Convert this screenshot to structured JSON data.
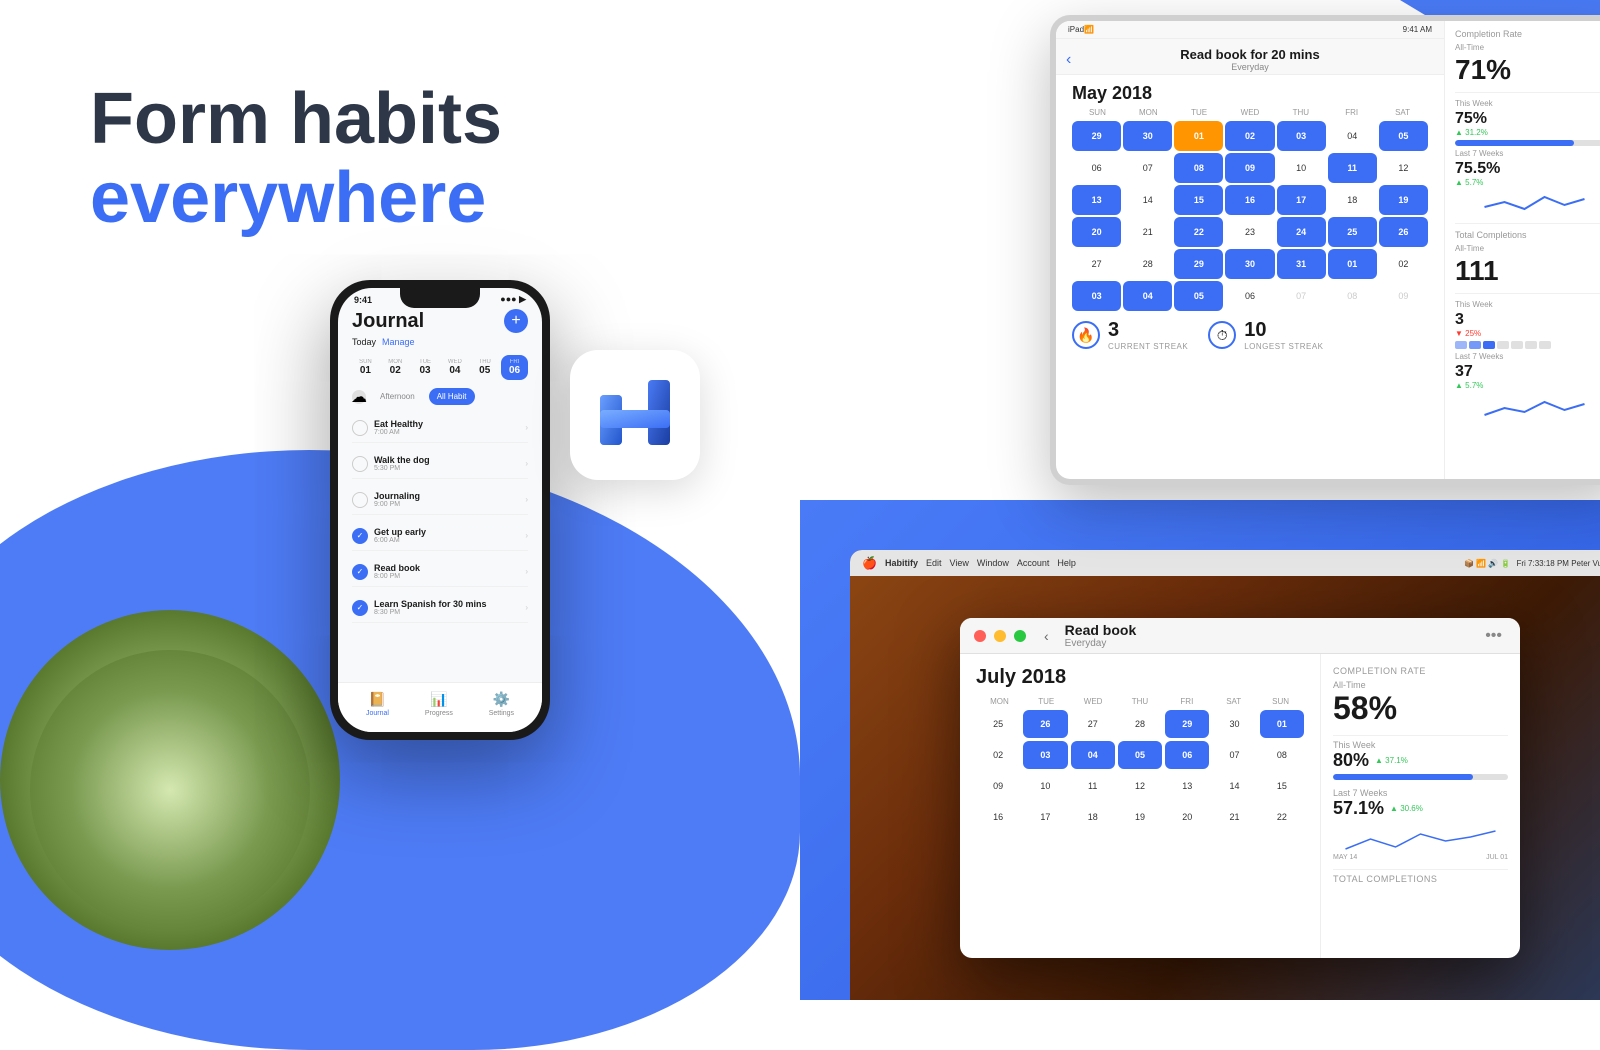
{
  "headline": {
    "line1": "Form habits",
    "line2": "everywhere"
  },
  "iphone": {
    "status_time": "9:41",
    "status_signal": "●●●",
    "title": "Journal",
    "today_label": "Today",
    "manage_label": "Manage",
    "add_button": "+",
    "dates": [
      {
        "day": "SUN",
        "num": "01",
        "active": false
      },
      {
        "day": "MON",
        "num": "02",
        "active": false
      },
      {
        "day": "TUE",
        "num": "03",
        "active": false
      },
      {
        "day": "WED",
        "num": "04",
        "active": false
      },
      {
        "day": "THU",
        "num": "05",
        "active": false
      },
      {
        "day": "FRI",
        "num": "06",
        "active": true
      }
    ],
    "filter_afternoon": "Afternoon",
    "filter_all": "All Habit",
    "habits": [
      {
        "name": "Eat Healthy",
        "time": "7:00 AM",
        "checked": false
      },
      {
        "name": "Walk the dog",
        "time": "5:30 PM",
        "checked": false
      },
      {
        "name": "Journaling",
        "time": "9:00 PM",
        "checked": false
      },
      {
        "name": "Get up early",
        "time": "6:00 AM",
        "checked": true
      },
      {
        "name": "Read book",
        "time": "8:00 PM",
        "checked": true
      },
      {
        "name": "Learn Spanish for 30 mins",
        "time": "8:30 PM",
        "checked": true
      }
    ],
    "nav_journal": "Journal",
    "nav_progress": "Progress",
    "nav_settings": "Settings"
  },
  "ipad": {
    "status_left": "iPad",
    "status_time": "9:41 AM",
    "back_label": "‹",
    "title": "Read book for 20 mins",
    "subtitle": "Everyday",
    "month": "May 2018",
    "days_header": [
      "SUN",
      "MON",
      "TUE",
      "WED",
      "THU",
      "FRI",
      "SAT"
    ],
    "current_streak_val": "3",
    "current_streak_label": "CURRENT STREAK",
    "longest_streak_val": "10",
    "longest_streak_label": "LONGEST STREAK",
    "stats": {
      "title": "Completion Rate",
      "all_time_label": "All-Time",
      "all_time_val": "71%",
      "this_week_label": "This Week",
      "this_week_val": "75%",
      "this_week_change": "▲ 31.2%",
      "last_7_label": "Last 7 Weeks",
      "last_7_val": "75.5%",
      "last_7_change": "▲ 5.7%",
      "total_title": "Total Completions",
      "total_all_label": "All-Time",
      "total_all_val": "111",
      "total_week_label": "This Week",
      "total_week_val": "3",
      "total_week_change": "▼ 25%",
      "total_7_label": "Last 7 Weeks",
      "total_7_val": "37",
      "total_7_change": "▲ 5.7%"
    }
  },
  "mac": {
    "menubar_apple": "",
    "menubar_app": "Habitify",
    "menu_edit": "Edit",
    "menu_view": "View",
    "menu_window": "Window",
    "menu_account": "Account",
    "menu_help": "Help",
    "menubar_right": "Fri 7:33:18 PM  Peter Vu",
    "window_title": "Read book",
    "window_subtitle": "Everyday",
    "month": "July 2018",
    "days_header": [
      "MON",
      "TUE",
      "WED",
      "THU",
      "FRI",
      "SAT",
      "SUN"
    ],
    "stats": {
      "title": "Completion Rate",
      "all_time_label": "All-Time",
      "all_time_val": "58%",
      "this_week_label": "This Week",
      "this_week_val": "80%",
      "this_week_change": "▲ 37.1%",
      "last_7_label": "Last 7 Weeks",
      "last_7_val": "57.1%",
      "last_7_change": "▲ 30.6%",
      "total_title": "Total Completions",
      "may14_label": "MAY 14",
      "jul01_label": "JUL 01"
    }
  },
  "colors": {
    "primary": "#3b6ef5",
    "text_dark": "#1a1a1a",
    "text_gray": "#888888",
    "green": "#34c759",
    "red": "#ff3b30",
    "orange": "#ff9500"
  }
}
